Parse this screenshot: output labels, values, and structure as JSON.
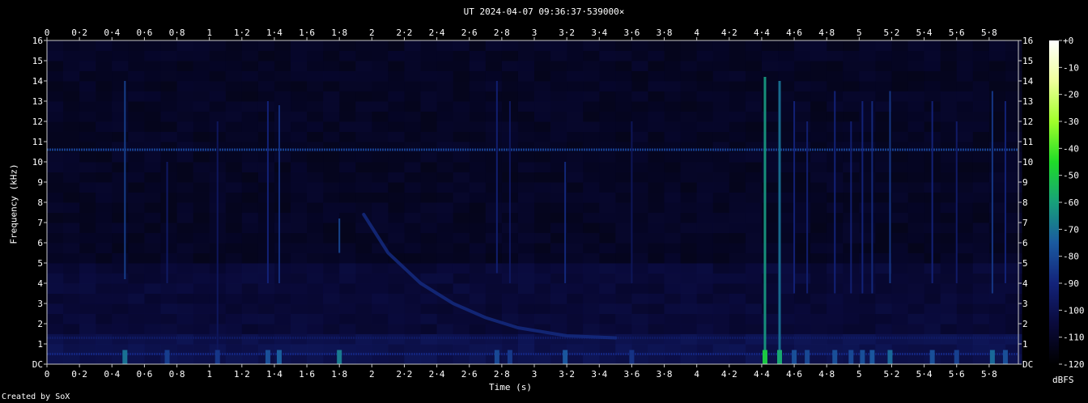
{
  "chart_data": {
    "type": "heatmap",
    "title": "UT 2024-04-07 09:36:37·539000×",
    "xlabel": "Time (s)",
    "ylabel": "Frequency (kHz)",
    "colorbar_label": "dBFS",
    "credit": "Created by SoX",
    "xlim": [
      0,
      5.98
    ],
    "ylim": [
      0,
      16
    ],
    "x_ticks": [
      "0",
      "0·2",
      "0·4",
      "0·6",
      "0·8",
      "1",
      "1·2",
      "1·4",
      "1·6",
      "1·8",
      "2",
      "2·2",
      "2·4",
      "2·6",
      "2·8",
      "3",
      "3·2",
      "3·4",
      "3·6",
      "3·8",
      "4",
      "4·2",
      "4·4",
      "4·6",
      "4·8",
      "5",
      "5·2",
      "5·4",
      "5·6",
      "5·8"
    ],
    "y_ticks": [
      "DC",
      "1",
      "2",
      "3",
      "4",
      "5",
      "6",
      "7",
      "8",
      "9",
      "10",
      "11",
      "12",
      "13",
      "14",
      "15",
      "16"
    ],
    "colorbar_ticks": [
      "+0",
      "-10",
      "-20",
      "-30",
      "-40",
      "-50",
      "-60",
      "-70",
      "-80",
      "-90",
      "-100",
      "-110",
      "-120"
    ],
    "colorbar_range": [
      -120,
      0
    ],
    "colormap": [
      "#000000",
      "#0a0a3c",
      "#13237a",
      "#1a5aa0",
      "#17a07a",
      "#1fdc28",
      "#a0ff2a",
      "#f0ff9c",
      "#ffffff"
    ],
    "horizontal_lines": [
      {
        "freq_khz": 10.6,
        "level_dbfs": -82
      },
      {
        "freq_khz": 1.3,
        "level_dbfs": -96
      },
      {
        "freq_khz": 0.5,
        "level_dbfs": -90
      }
    ],
    "transients": [
      {
        "time_s": 0.48,
        "fmin_khz": 4.2,
        "fmax_khz": 14.0,
        "level_dbfs": -82
      },
      {
        "time_s": 0.74,
        "fmin_khz": 4.0,
        "fmax_khz": 10.0,
        "level_dbfs": -95
      },
      {
        "time_s": 1.05,
        "fmin_khz": 0,
        "fmax_khz": 12.0,
        "level_dbfs": -97
      },
      {
        "time_s": 1.36,
        "fmin_khz": 4.0,
        "fmax_khz": 13.0,
        "level_dbfs": -90
      },
      {
        "time_s": 1.43,
        "fmin_khz": 4.0,
        "fmax_khz": 12.8,
        "level_dbfs": -86
      },
      {
        "time_s": 1.8,
        "fmin_khz": 5.5,
        "fmax_khz": 7.2,
        "level_dbfs": -80
      },
      {
        "time_s": 2.77,
        "fmin_khz": 4.5,
        "fmax_khz": 14.0,
        "level_dbfs": -92
      },
      {
        "time_s": 2.85,
        "fmin_khz": 4.0,
        "fmax_khz": 13.0,
        "level_dbfs": -96
      },
      {
        "time_s": 3.19,
        "fmin_khz": 4.0,
        "fmax_khz": 10.0,
        "level_dbfs": -88
      },
      {
        "time_s": 3.6,
        "fmin_khz": 4.0,
        "fmax_khz": 12.0,
        "level_dbfs": -98
      },
      {
        "time_s": 4.42,
        "fmin_khz": 0,
        "fmax_khz": 14.2,
        "level_dbfs": -62
      },
      {
        "time_s": 4.51,
        "fmin_khz": 0,
        "fmax_khz": 14.0,
        "level_dbfs": -70
      },
      {
        "time_s": 4.6,
        "fmin_khz": 3.5,
        "fmax_khz": 13.0,
        "level_dbfs": -90
      },
      {
        "time_s": 4.68,
        "fmin_khz": 3.5,
        "fmax_khz": 12.0,
        "level_dbfs": -92
      },
      {
        "time_s": 4.85,
        "fmin_khz": 3.5,
        "fmax_khz": 13.5,
        "level_dbfs": -90
      },
      {
        "time_s": 4.95,
        "fmin_khz": 3.5,
        "fmax_khz": 12.0,
        "level_dbfs": -92
      },
      {
        "time_s": 5.02,
        "fmin_khz": 3.5,
        "fmax_khz": 13.0,
        "level_dbfs": -90
      },
      {
        "time_s": 5.08,
        "fmin_khz": 3.5,
        "fmax_khz": 13.0,
        "level_dbfs": -88
      },
      {
        "time_s": 5.19,
        "fmin_khz": 4.0,
        "fmax_khz": 13.5,
        "level_dbfs": -84
      },
      {
        "time_s": 5.45,
        "fmin_khz": 4.0,
        "fmax_khz": 13.0,
        "level_dbfs": -90
      },
      {
        "time_s": 5.6,
        "fmin_khz": 4.0,
        "fmax_khz": 12.0,
        "level_dbfs": -94
      },
      {
        "time_s": 5.82,
        "fmin_khz": 3.5,
        "fmax_khz": 13.5,
        "level_dbfs": -84
      },
      {
        "time_s": 5.9,
        "fmin_khz": 4.0,
        "fmax_khz": 13.0,
        "level_dbfs": -90
      }
    ],
    "sweep": {
      "level_dbfs": -88,
      "points": [
        [
          1.95,
          7.4
        ],
        [
          2.1,
          5.5
        ],
        [
          2.3,
          4.0
        ],
        [
          2.5,
          3.0
        ],
        [
          2.7,
          2.3
        ],
        [
          2.9,
          1.8
        ],
        [
          3.2,
          1.4
        ],
        [
          3.5,
          1.3
        ]
      ]
    }
  }
}
